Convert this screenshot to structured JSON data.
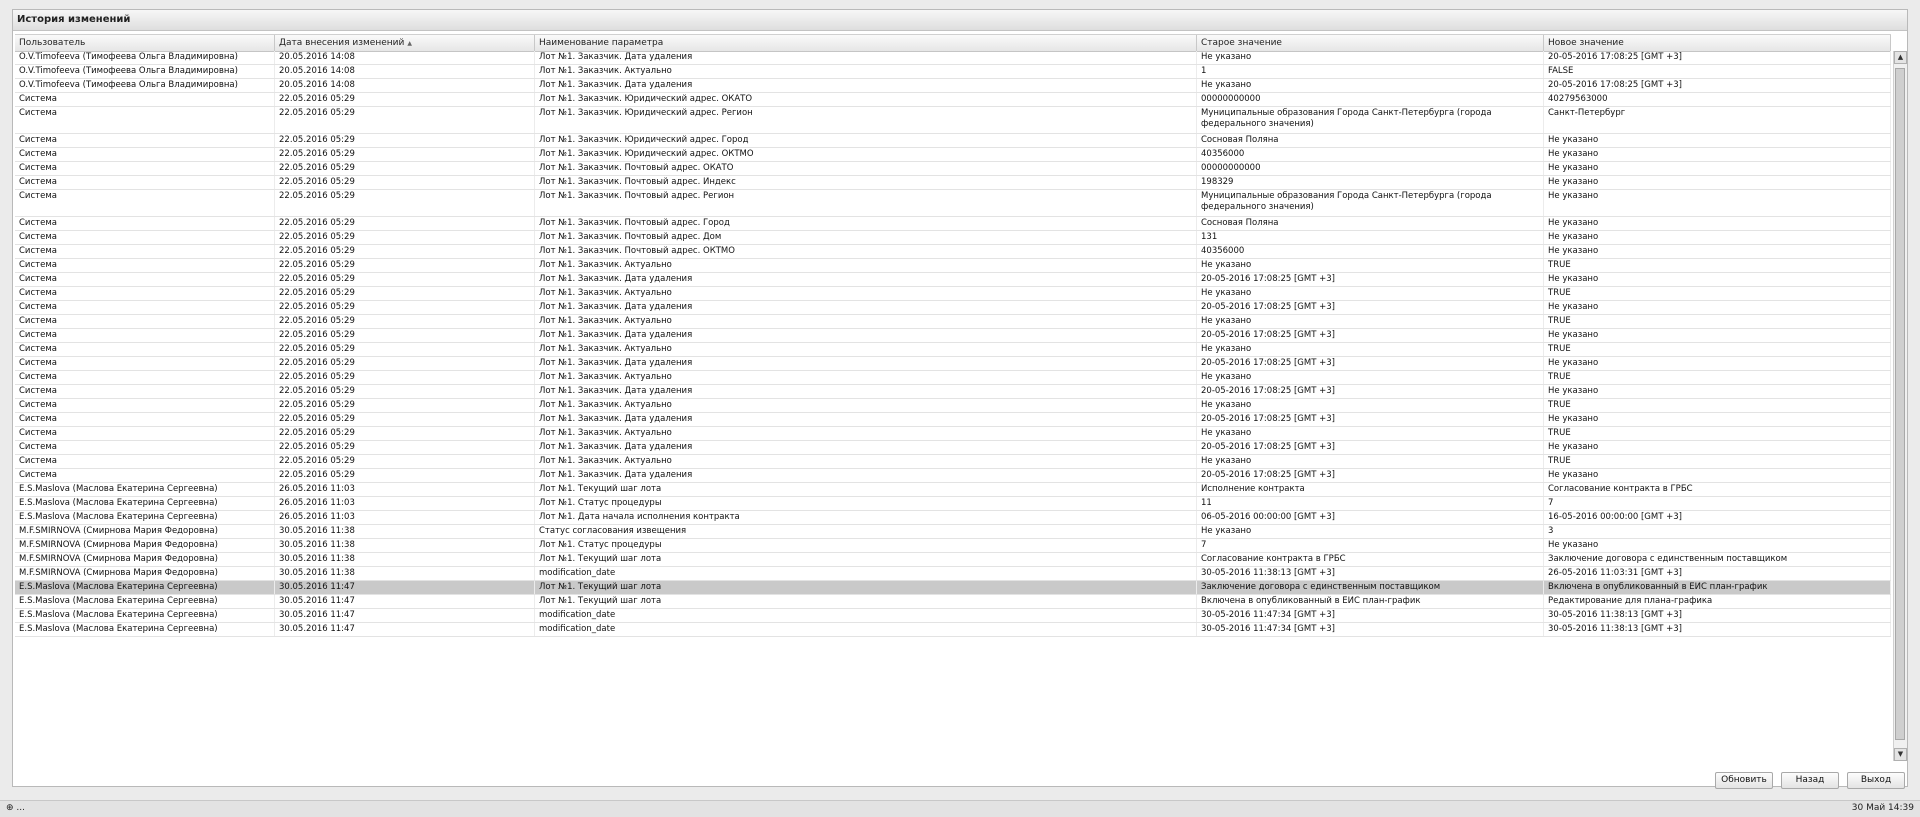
{
  "window": {
    "title": "История изменений"
  },
  "columns": [
    {
      "label": "Пользователь"
    },
    {
      "label": "Дата внесения изменений",
      "sorted": true
    },
    {
      "label": "Наименование параметра"
    },
    {
      "label": "Старое значение"
    },
    {
      "label": "Новое значение"
    }
  ],
  "rows": [
    [
      "O.V.Timofeeva (Тимофеева Ольга Владимировна)",
      "20.05.2016 14:08",
      "Лот №1. Заказчик. Дата удаления",
      "Не указано",
      "20-05-2016 17:08:25 [GMT +3]"
    ],
    [
      "O.V.Timofeeva (Тимофеева Ольга Владимировна)",
      "20.05.2016 14:08",
      "Лот №1. Заказчик. Актуально",
      "1",
      "FALSE"
    ],
    [
      "O.V.Timofeeva (Тимофеева Ольга Владимировна)",
      "20.05.2016 14:08",
      "Лот №1. Заказчик. Дата удаления",
      "Не указано",
      "20-05-2016 17:08:25 [GMT +3]"
    ],
    [
      "Система",
      "22.05.2016 05:29",
      "Лот №1. Заказчик. Юридический адрес. ОКАТО",
      "00000000000",
      "40279563000"
    ],
    [
      "Система",
      "22.05.2016 05:29",
      "Лот №1. Заказчик. Юридический адрес. Регион",
      "Муниципальные образования Города Санкт-Петербурга (города федерального значения)",
      "Санкт-Петербург"
    ],
    [
      "Система",
      "22.05.2016 05:29",
      "Лот №1. Заказчик. Юридический адрес. Город",
      "Сосновая Поляна",
      "Не указано"
    ],
    [
      "Система",
      "22.05.2016 05:29",
      "Лот №1. Заказчик. Юридический адрес. ОКТМО",
      "40356000",
      "Не указано"
    ],
    [
      "Система",
      "22.05.2016 05:29",
      "Лот №1. Заказчик. Почтовый адрес. ОКАТО",
      "00000000000",
      "Не указано"
    ],
    [
      "Система",
      "22.05.2016 05:29",
      "Лот №1. Заказчик. Почтовый адрес. Индекс",
      "198329",
      "Не указано"
    ],
    [
      "Система",
      "22.05.2016 05:29",
      "Лот №1. Заказчик. Почтовый адрес. Регион",
      "Муниципальные образования Города Санкт-Петербурга (города федерального значения)",
      "Не указано"
    ],
    [
      "Система",
      "22.05.2016 05:29",
      "Лот №1. Заказчик. Почтовый адрес. Город",
      "Сосновая Поляна",
      "Не указано"
    ],
    [
      "Система",
      "22.05.2016 05:29",
      "Лот №1. Заказчик. Почтовый адрес. Дом",
      "131",
      "Не указано"
    ],
    [
      "Система",
      "22.05.2016 05:29",
      "Лот №1. Заказчик. Почтовый адрес. ОКТМО",
      "40356000",
      "Не указано"
    ],
    [
      "Система",
      "22.05.2016 05:29",
      "Лот №1. Заказчик. Актуально",
      "Не указано",
      "TRUE"
    ],
    [
      "Система",
      "22.05.2016 05:29",
      "Лот №1. Заказчик. Дата удаления",
      "20-05-2016 17:08:25 [GMT +3]",
      "Не указано"
    ],
    [
      "Система",
      "22.05.2016 05:29",
      "Лот №1. Заказчик. Актуально",
      "Не указано",
      "TRUE"
    ],
    [
      "Система",
      "22.05.2016 05:29",
      "Лот №1. Заказчик. Дата удаления",
      "20-05-2016 17:08:25 [GMT +3]",
      "Не указано"
    ],
    [
      "Система",
      "22.05.2016 05:29",
      "Лот №1. Заказчик. Актуально",
      "Не указано",
      "TRUE"
    ],
    [
      "Система",
      "22.05.2016 05:29",
      "Лот №1. Заказчик. Дата удаления",
      "20-05-2016 17:08:25 [GMT +3]",
      "Не указано"
    ],
    [
      "Система",
      "22.05.2016 05:29",
      "Лот №1. Заказчик. Актуально",
      "Не указано",
      "TRUE"
    ],
    [
      "Система",
      "22.05.2016 05:29",
      "Лот №1. Заказчик. Дата удаления",
      "20-05-2016 17:08:25 [GMT +3]",
      "Не указано"
    ],
    [
      "Система",
      "22.05.2016 05:29",
      "Лот №1. Заказчик. Актуально",
      "Не указано",
      "TRUE"
    ],
    [
      "Система",
      "22.05.2016 05:29",
      "Лот №1. Заказчик. Дата удаления",
      "20-05-2016 17:08:25 [GMT +3]",
      "Не указано"
    ],
    [
      "Система",
      "22.05.2016 05:29",
      "Лот №1. Заказчик. Актуально",
      "Не указано",
      "TRUE"
    ],
    [
      "Система",
      "22.05.2016 05:29",
      "Лот №1. Заказчик. Дата удаления",
      "20-05-2016 17:08:25 [GMT +3]",
      "Не указано"
    ],
    [
      "Система",
      "22.05.2016 05:29",
      "Лот №1. Заказчик. Актуально",
      "Не указано",
      "TRUE"
    ],
    [
      "Система",
      "22.05.2016 05:29",
      "Лот №1. Заказчик. Дата удаления",
      "20-05-2016 17:08:25 [GMT +3]",
      "Не указано"
    ],
    [
      "Система",
      "22.05.2016 05:29",
      "Лот №1. Заказчик. Актуально",
      "Не указано",
      "TRUE"
    ],
    [
      "Система",
      "22.05.2016 05:29",
      "Лот №1. Заказчик. Дата удаления",
      "20-05-2016 17:08:25 [GMT +3]",
      "Не указано"
    ],
    [
      "E.S.Maslova (Маслова Екатерина Сергеевна)",
      "26.05.2016 11:03",
      "Лот №1. Текущий шаг лота",
      "Исполнение контракта",
      "Согласование контракта в ГРБС"
    ],
    [
      "E.S.Maslova (Маслова Екатерина Сергеевна)",
      "26.05.2016 11:03",
      "Лот №1. Статус процедуры",
      "11",
      "7"
    ],
    [
      "E.S.Maslova (Маслова Екатерина Сергеевна)",
      "26.05.2016 11:03",
      "Лот №1. Дата начала исполнения контракта",
      "06-05-2016 00:00:00 [GMT +3]",
      "16-05-2016 00:00:00 [GMT +3]"
    ],
    [
      "M.F.SMIRNOVA (Смирнова Мария Федоровна)",
      "30.05.2016 11:38",
      "Статус согласования извещения",
      "Не указано",
      "3"
    ],
    [
      "M.F.SMIRNOVA (Смирнова Мария Федоровна)",
      "30.05.2016 11:38",
      "Лот №1. Статус процедуры",
      "7",
      "Не указано"
    ],
    [
      "M.F.SMIRNOVA (Смирнова Мария Федоровна)",
      "30.05.2016 11:38",
      "Лот №1. Текущий шаг лота",
      "Согласование контракта в ГРБС",
      "Заключение договора с единственным поставщиком"
    ],
    [
      "M.F.SMIRNOVA (Смирнова Мария Федоровна)",
      "30.05.2016 11:38",
      "modification_date",
      "30-05-2016 11:38:13 [GMT +3]",
      "26-05-2016 11:03:31 [GMT +3]"
    ],
    [
      "E.S.Maslova (Маслова Екатерина Сергеевна)",
      "30.05.2016 11:47",
      "Лот №1. Текущий шаг лота",
      "Заключение договора с единственным поставщиком",
      "Включена в опубликованный в ЕИС план-график"
    ],
    [
      "E.S.Maslova (Маслова Екатерина Сергеевна)",
      "30.05.2016 11:47",
      "Лот №1. Текущий шаг лота",
      "Включена в опубликованный в ЕИС план-график",
      "Редактирование для плана-графика"
    ],
    [
      "E.S.Maslova (Маслова Екатерина Сергеевна)",
      "30.05.2016 11:47",
      "modification_date",
      "30-05-2016 11:47:34 [GMT +3]",
      "30-05-2016 11:38:13 [GMT +3]"
    ],
    [
      "E.S.Maslova (Маслова Екатерина Сергеевна)",
      "30.05.2016 11:47",
      "modification_date",
      "30-05-2016 11:47:34 [GMT +3]",
      "30-05-2016 11:38:13 [GMT +3]"
    ]
  ],
  "selected_row": 36,
  "buttons": {
    "refresh": "Обновить",
    "back": "Назад",
    "exit": "Выход"
  },
  "statusbar": {
    "left": "⊕ ...",
    "right": "30 Май 14:39"
  },
  "colors": {
    "selected_row": "#c9c9c9",
    "panel_bg": "#ffffff",
    "page_bg": "#ebebeb"
  }
}
